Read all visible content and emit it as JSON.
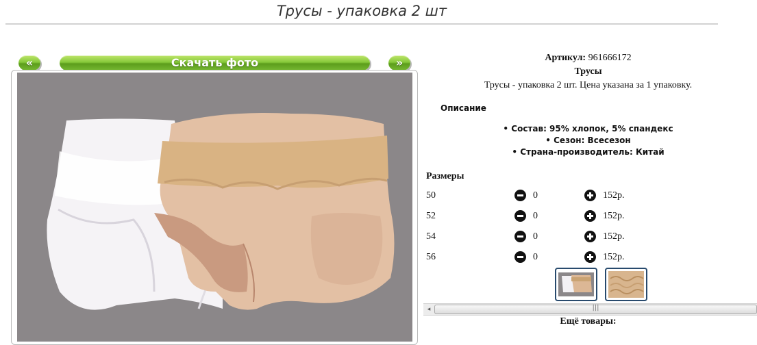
{
  "page": {
    "title": "Трусы - упаковка 2 шт"
  },
  "gallery": {
    "prev_label": "«",
    "download_label": "Скачать фото",
    "next_label": "»",
    "colors": {
      "button_green": "#7cc03a",
      "photo_bg": "#8b8789"
    }
  },
  "product": {
    "article_label": "Артикул:",
    "article_value": "961666172",
    "name": "Трусы",
    "subtitle": "Трусы - упаковка 2 шт. Цена указана за 1 упаковку.",
    "description_heading": "Описание",
    "features": [
      "Состав: 95% хлопок, 5% спандекс",
      "Сезон: Всесезон",
      "Страна-производитель: Китай"
    ]
  },
  "sizes": {
    "heading": "Размеры",
    "rows": [
      {
        "size": "50",
        "qty": "0",
        "price": "152р."
      },
      {
        "size": "52",
        "qty": "0",
        "price": "152р."
      },
      {
        "size": "54",
        "qty": "0",
        "price": "152р."
      },
      {
        "size": "56",
        "qty": "0",
        "price": "152р."
      }
    ]
  },
  "thumbnails": [
    {
      "icon": "thumbnail-pair-photo"
    },
    {
      "icon": "thumbnail-lace-detail"
    }
  ],
  "scrollbar": {
    "left_arrow": "◂",
    "grip": "|||"
  },
  "more": {
    "label": "Ещё товары:"
  }
}
